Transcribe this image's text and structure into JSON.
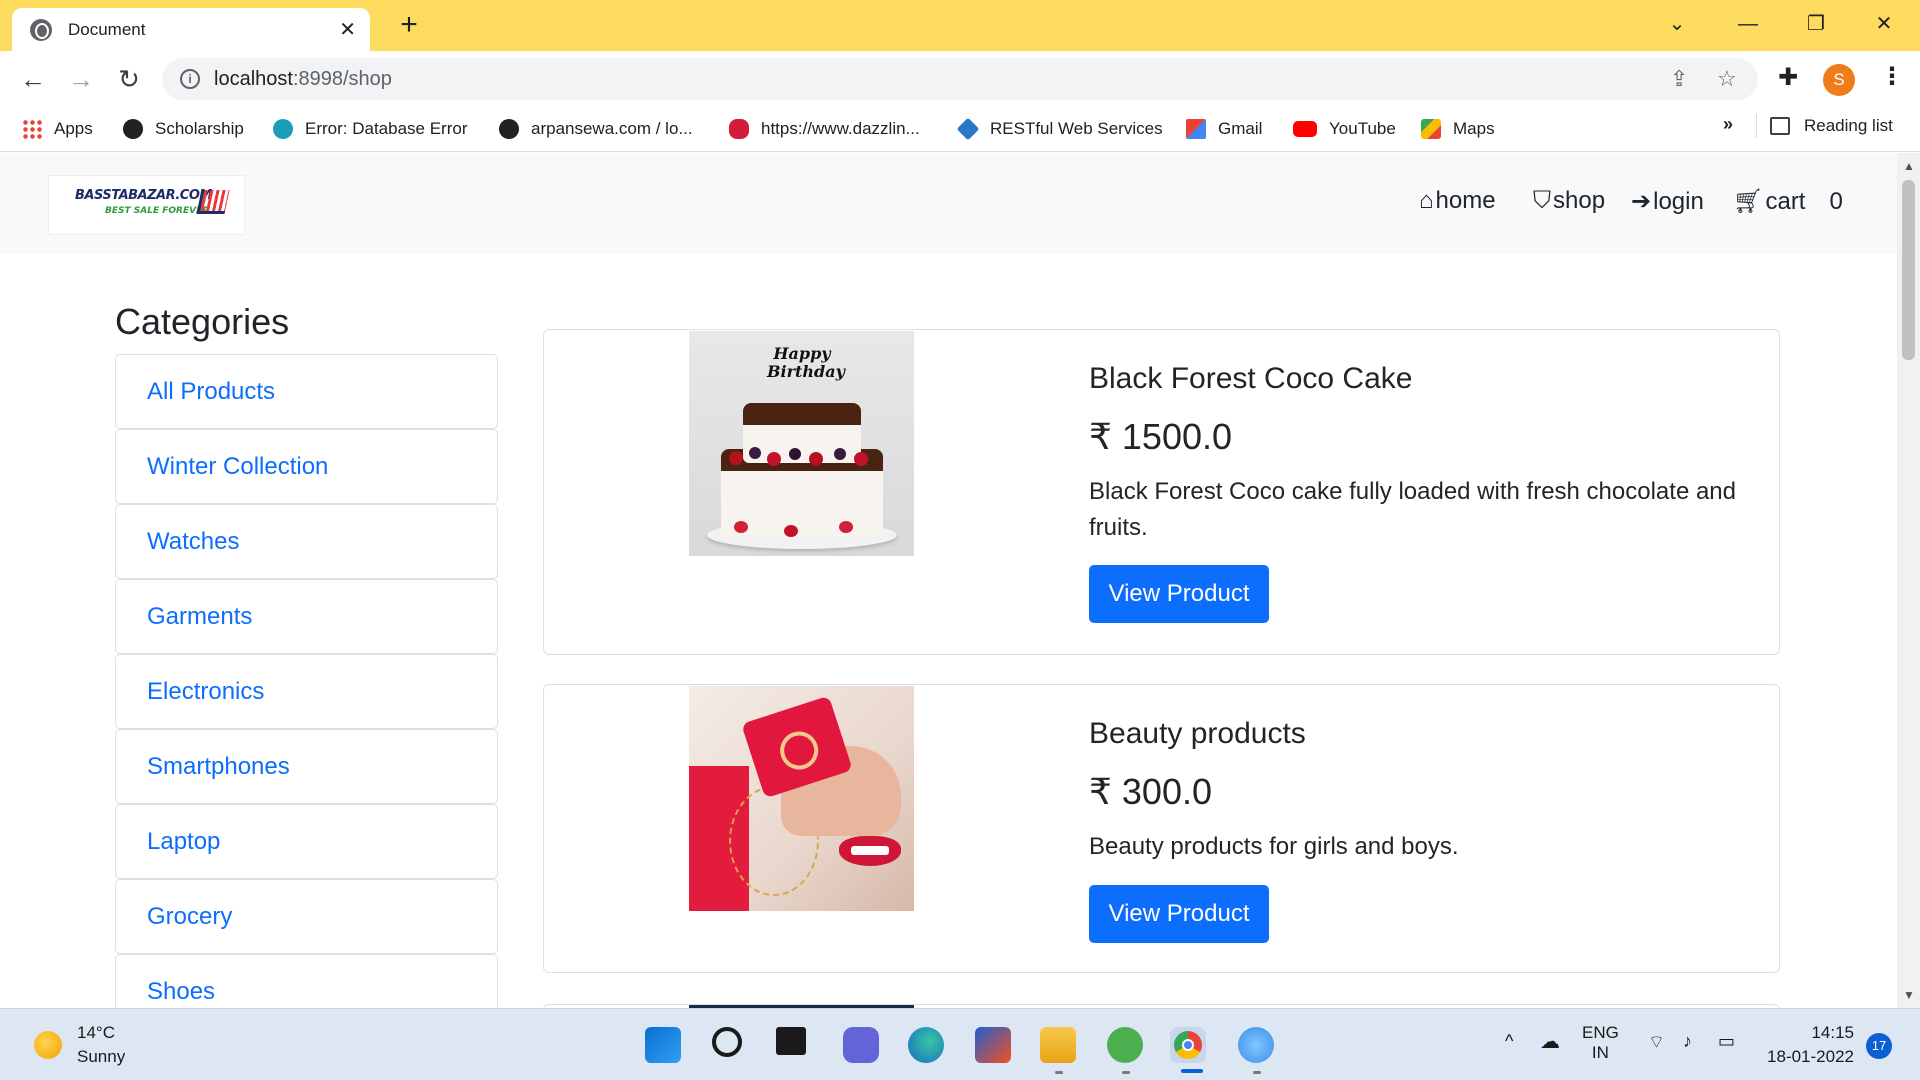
{
  "browser": {
    "tab_title": "Document",
    "tab_close": "✕",
    "new_tab": "+",
    "url_host": "localhost",
    "url_rest": ":8998/shop",
    "bookmarks": [
      {
        "label": "Apps",
        "icon": "apps-grid-icon"
      },
      {
        "label": "Scholarship",
        "icon": "globe-icon"
      },
      {
        "label": "Error: Database Error",
        "icon": "database-icon"
      },
      {
        "label": "arpansewa.com / lo...",
        "icon": "globe-icon"
      },
      {
        "label": "https://www.dazzlin...",
        "icon": "lips-icon"
      },
      {
        "label": "RESTful Web Services",
        "icon": "diamond-icon"
      },
      {
        "label": "Gmail",
        "icon": "gmail-icon"
      },
      {
        "label": "YouTube",
        "icon": "youtube-icon"
      },
      {
        "label": "Maps",
        "icon": "maps-icon"
      }
    ],
    "bookmarks_more": "»",
    "reading_list": "Reading list",
    "profile_initial": "S"
  },
  "site": {
    "logo_line1": "BASSTABAZAR.COM",
    "logo_line2": "BEST SALE FOREVER",
    "nav": {
      "home": "home",
      "shop": "shop",
      "login": "login",
      "cart": "cart",
      "cart_count": "0"
    }
  },
  "categories": {
    "heading": "Categories",
    "items": [
      "All Products",
      "Winter Collection",
      "Watches",
      "Garments",
      "Electronics",
      "Smartphones",
      "Laptop",
      "Grocery",
      "Shoes"
    ]
  },
  "products": [
    {
      "name": "Black Forest Coco Cake",
      "price": "₹ 1500.0",
      "description": "Black Forest Coco cake fully loaded with fresh chocolate and fruits.",
      "button": "View Product",
      "topper_text": "Happy Birthday"
    },
    {
      "name": "Beauty products",
      "price": "₹ 300.0",
      "description": "Beauty products for girls and boys.",
      "button": "View Product"
    }
  ],
  "taskbar": {
    "temperature": "14°C",
    "condition": "Sunny",
    "lang_top": "ENG",
    "lang_bottom": "IN",
    "time": "14:15",
    "date": "18-01-2022",
    "notifications": "17"
  },
  "colors": {
    "tabbar": "#fcdb5e",
    "primary": "#0d6efd",
    "nav_bg": "#f8f9fa"
  }
}
